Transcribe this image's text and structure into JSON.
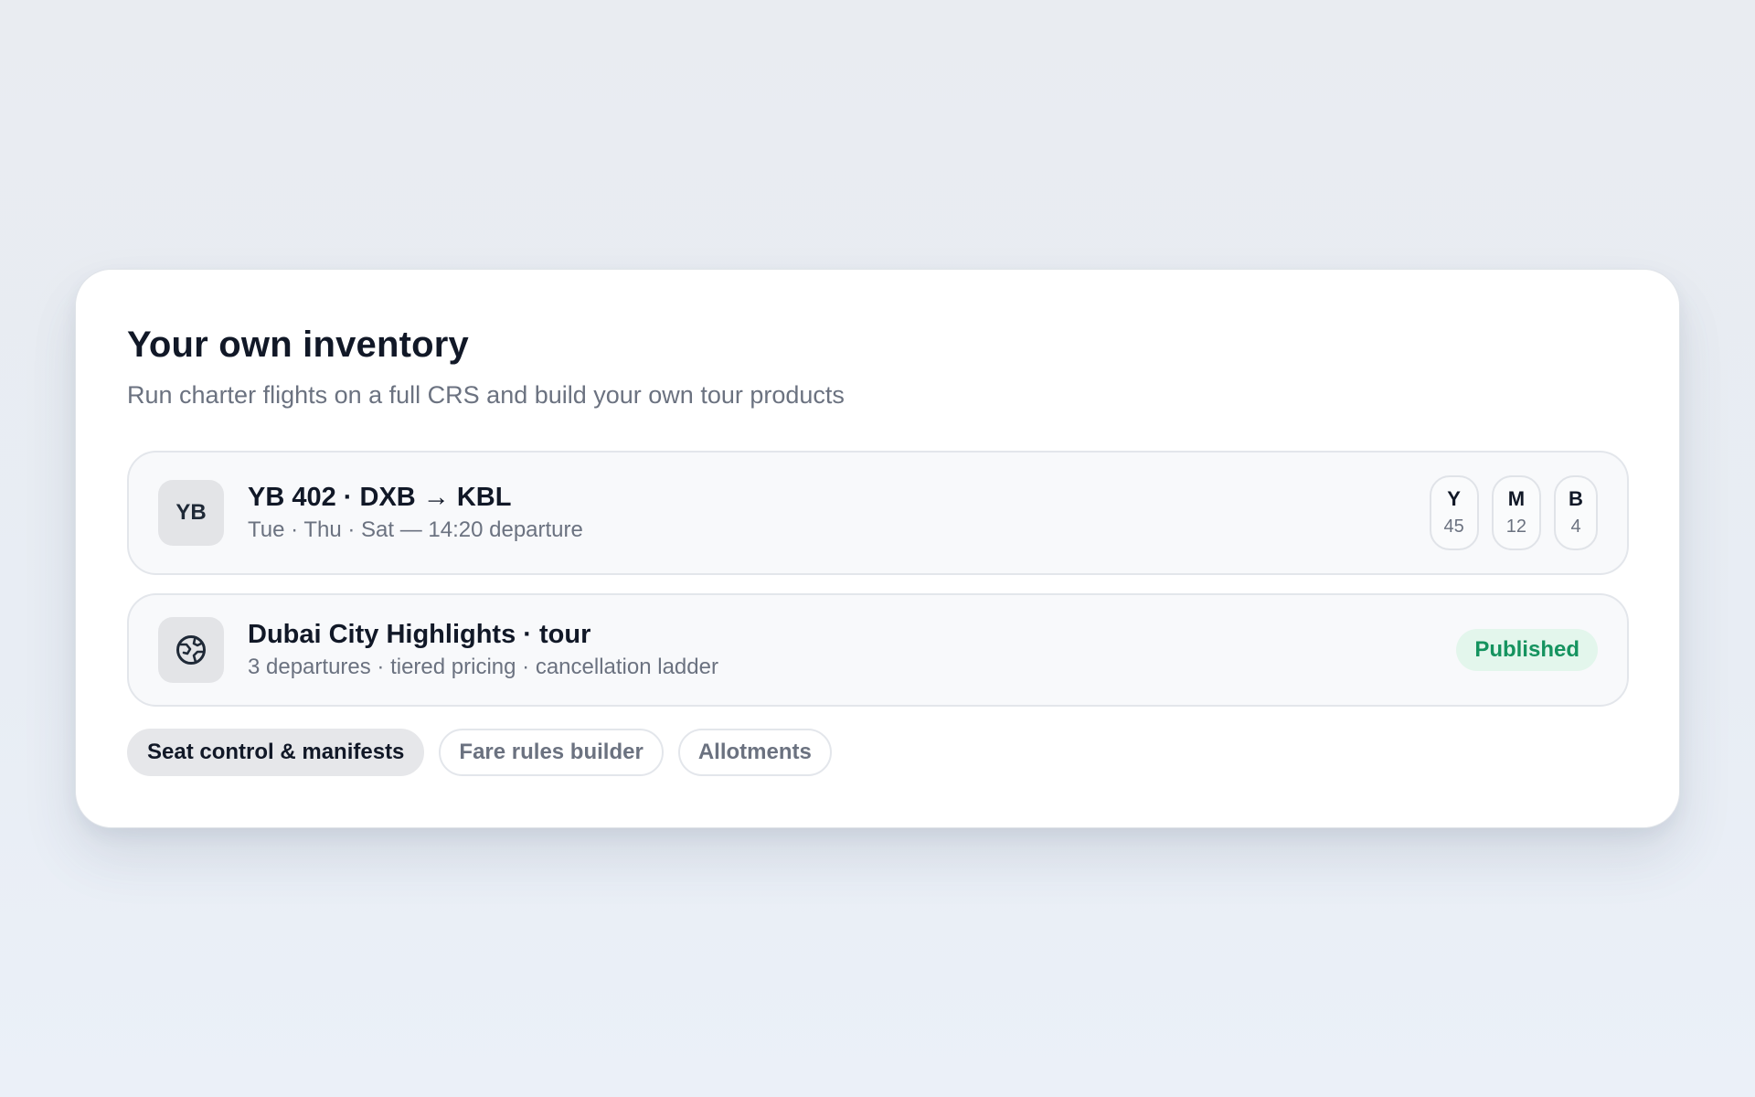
{
  "card": {
    "title": "Your own inventory",
    "subtitle": "Run charter flights on a full CRS and build your own tour products"
  },
  "flight": {
    "avatar": "YB",
    "title": "YB 402 · DXB → KBL",
    "subtitle": "Tue · Thu · Sat — 14:20 departure",
    "classes": [
      {
        "code": "Y",
        "count": "45"
      },
      {
        "code": "M",
        "count": "12"
      },
      {
        "code": "B",
        "count": "4"
      }
    ]
  },
  "tour": {
    "icon": "globe-icon",
    "title": "Dubai City Highlights · tour",
    "subtitle": "3 departures · tiered pricing · cancellation ladder",
    "status": "Published",
    "status_color": "#15935f"
  },
  "chips": [
    {
      "label": "Seat control & manifests",
      "active": true
    },
    {
      "label": "Fare rules builder",
      "active": false
    },
    {
      "label": "Allotments",
      "active": false
    }
  ]
}
